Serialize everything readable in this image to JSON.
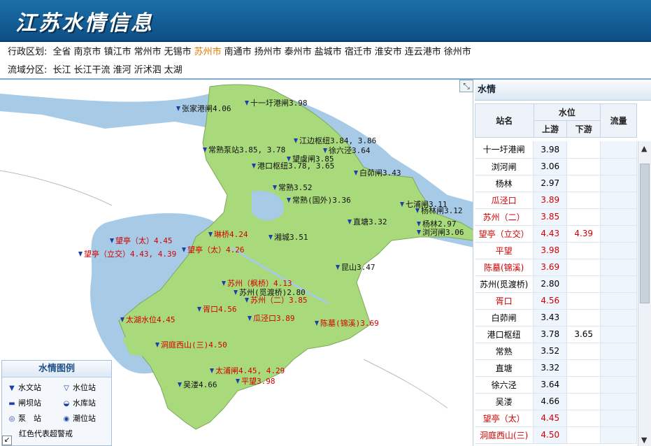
{
  "header": {
    "title": "江苏水情信息"
  },
  "filter_admin": {
    "label": "行政区划:",
    "options": [
      "全省",
      "南京市",
      "镇江市",
      "常州市",
      "无锡市",
      "苏州市",
      "南通市",
      "扬州市",
      "泰州市",
      "盐城市",
      "宿迁市",
      "淮安市",
      "连云港市",
      "徐州市"
    ],
    "selected": "苏州市"
  },
  "filter_basin": {
    "label": "流域分区:",
    "options": [
      "长江",
      "长江干流",
      "淮河",
      "沂沭泗",
      "太湖"
    ]
  },
  "legend": {
    "title": "水情图例",
    "items": [
      "水文站",
      "水位站",
      "闸坝站",
      "水库站",
      "泵　站",
      "潮位站"
    ],
    "note": "红色代表超警戒"
  },
  "panel": {
    "title": "水情",
    "headers": {
      "station": "站名",
      "level": "水位",
      "up": "上游",
      "down": "下游",
      "flow": "流量"
    },
    "rows": [
      {
        "name": "十一圩港闸",
        "up": "3.98",
        "down": "",
        "flow": "",
        "alert": false
      },
      {
        "name": "浏河闸",
        "up": "3.06",
        "down": "",
        "flow": "",
        "alert": false
      },
      {
        "name": "杨林",
        "up": "2.97",
        "down": "",
        "flow": "",
        "alert": false
      },
      {
        "name": "瓜泾口",
        "up": "3.89",
        "down": "",
        "flow": "",
        "alert": true
      },
      {
        "name": "苏州（二）",
        "up": "3.85",
        "down": "",
        "flow": "",
        "alert": true
      },
      {
        "name": "望亭（立交）",
        "up": "4.43",
        "down": "4.39",
        "flow": "",
        "alert": true
      },
      {
        "name": "平望",
        "up": "3.98",
        "down": "",
        "flow": "",
        "alert": true
      },
      {
        "name": "陈墓(锦溪)",
        "up": "3.69",
        "down": "",
        "flow": "",
        "alert": true
      },
      {
        "name": "苏州(觅渡桥)",
        "up": "2.80",
        "down": "",
        "flow": "",
        "alert": false
      },
      {
        "name": "胥口",
        "up": "4.56",
        "down": "",
        "flow": "",
        "alert": true
      },
      {
        "name": "白茆闸",
        "up": "3.43",
        "down": "",
        "flow": "",
        "alert": false
      },
      {
        "name": "港口枢纽",
        "up": "3.78",
        "down": "3.65",
        "flow": "",
        "alert": false
      },
      {
        "name": "常熟",
        "up": "3.52",
        "down": "",
        "flow": "",
        "alert": false
      },
      {
        "name": "直塘",
        "up": "3.32",
        "down": "",
        "flow": "",
        "alert": false
      },
      {
        "name": "徐六泾",
        "up": "3.64",
        "down": "",
        "flow": "",
        "alert": false
      },
      {
        "name": "吴溇",
        "up": "4.66",
        "down": "",
        "flow": "",
        "alert": false
      },
      {
        "name": "望亭（太）",
        "up": "4.45",
        "down": "",
        "flow": "",
        "alert": true
      },
      {
        "name": "洞庭西山(三)",
        "up": "4.50",
        "down": "",
        "flow": "",
        "alert": true
      }
    ]
  },
  "map_labels": [
    {
      "text": "张家港闸4.06",
      "red": false
    },
    {
      "text": "十一圩港闸3.98",
      "red": false
    },
    {
      "text": "江边枢纽3.84, 3.86",
      "red": false
    },
    {
      "text": "常熟泵站3.85, 3.78",
      "red": false
    },
    {
      "text": "徐六泾3.64",
      "red": false
    },
    {
      "text": "望虞闸3.85",
      "red": false
    },
    {
      "text": "港口枢纽3.78, 3.65",
      "red": false
    },
    {
      "text": "白茆闸3.43",
      "red": false
    },
    {
      "text": "常熟3.52",
      "red": false
    },
    {
      "text": "常熟(国外)3.36",
      "red": false
    },
    {
      "text": "七浦闸3.11",
      "red": false
    },
    {
      "text": "杨林闸3.12",
      "red": false
    },
    {
      "text": "杨林2.97",
      "red": false
    },
    {
      "text": "浏河闸3.06",
      "red": false
    },
    {
      "text": "直塘3.32",
      "red": false
    },
    {
      "text": "琳桥4.24",
      "red": true
    },
    {
      "text": "湘城3.51",
      "red": false
    },
    {
      "text": "望亭（太）4.45",
      "red": true
    },
    {
      "text": "望亭（立交）4.43, 4.39",
      "red": true
    },
    {
      "text": "望亭（太）4.26",
      "red": true
    },
    {
      "text": "昆山3.47",
      "red": false
    },
    {
      "text": "苏州（枫桥）4.13",
      "red": true
    },
    {
      "text": "苏州(觅渡桥)2.80",
      "red": false
    },
    {
      "text": "苏州（二）3.85",
      "red": true
    },
    {
      "text": "胥口4.56",
      "red": true
    },
    {
      "text": "瓜泾口3.89",
      "red": true
    },
    {
      "text": "陈墓(锦溪)3.69",
      "red": true
    },
    {
      "text": "太湖水位4.45",
      "red": true
    },
    {
      "text": "洞庭西山(三)4.50",
      "red": true
    },
    {
      "text": "太浦闸4.45, 4.29",
      "red": true
    },
    {
      "text": "吴溇4.66",
      "red": false
    },
    {
      "text": "平望3.98",
      "red": true
    }
  ],
  "colors": {
    "land": "#a8d97b",
    "water": "#a7cbe6",
    "alert": "#d30000",
    "header": "#0d4f86"
  }
}
